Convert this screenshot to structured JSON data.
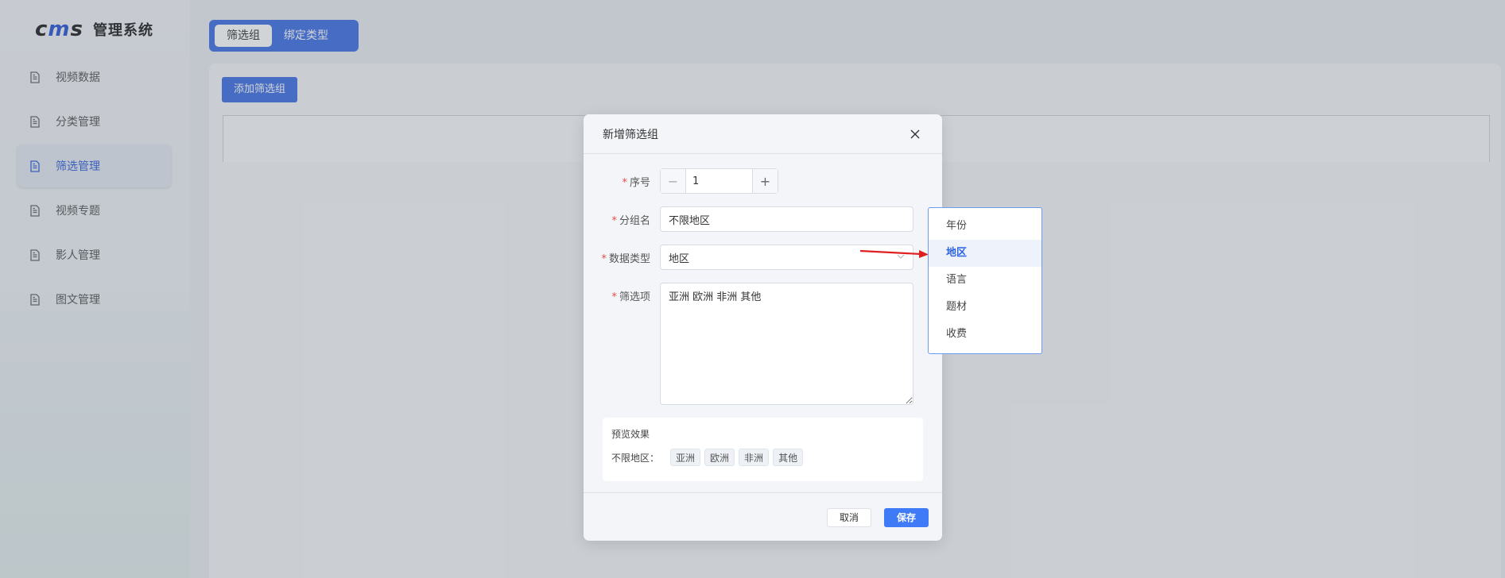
{
  "app": {
    "logo_text": "cms",
    "title": "管理系统"
  },
  "sidebar": {
    "items": [
      {
        "label": "视频数据",
        "active": false
      },
      {
        "label": "分类管理",
        "active": false
      },
      {
        "label": "筛选管理",
        "active": true
      },
      {
        "label": "视频专题",
        "active": false
      },
      {
        "label": "影人管理",
        "active": false
      },
      {
        "label": "图文管理",
        "active": false
      }
    ]
  },
  "tabs": [
    {
      "label": "筛选组",
      "active": true
    },
    {
      "label": "绑定类型",
      "active": false
    }
  ],
  "toolbar": {
    "add_label": "添加筛选组"
  },
  "dialog": {
    "title": "新增筛选组",
    "fields": {
      "order_label": "序号",
      "order_value": "1",
      "group_name_label": "分组名",
      "group_name_value": "不限地区",
      "data_type_label": "数据类型",
      "data_type_value": "地区",
      "options_label": "筛选项",
      "options_value": "亚洲 欧洲 非洲 其他"
    },
    "preview": {
      "title": "预览效果",
      "row_label": "不限地区：",
      "tags": [
        "亚洲",
        "欧洲",
        "非洲",
        "其他"
      ]
    },
    "cancel_label": "取消",
    "save_label": "保存"
  },
  "dropdown": {
    "options": [
      "年份",
      "地区",
      "语言",
      "题材",
      "收费"
    ],
    "selected": "地区"
  },
  "colors": {
    "accent": "#3f6fe3",
    "required": "#e34d4d",
    "arrow": "#e02020"
  }
}
